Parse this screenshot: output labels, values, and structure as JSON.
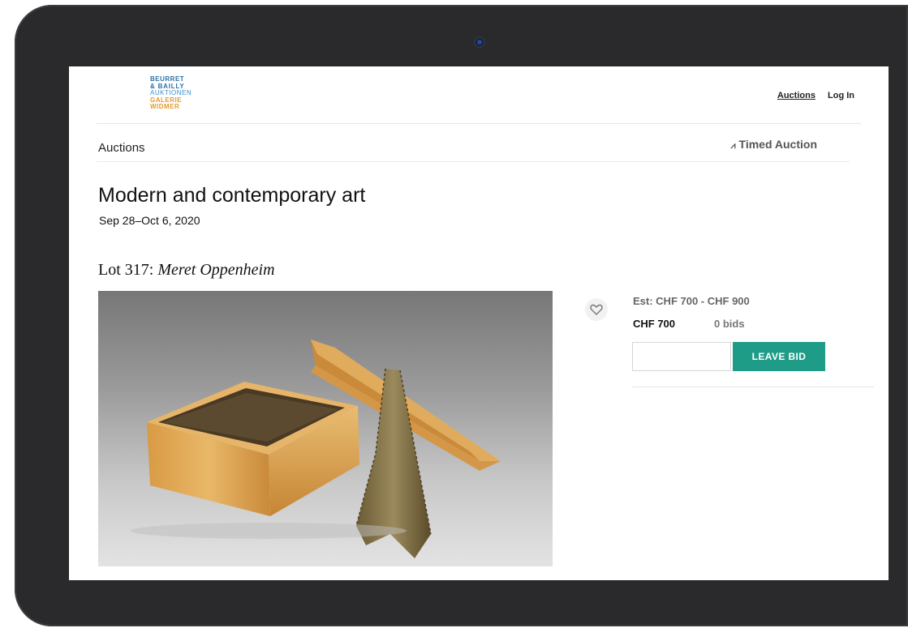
{
  "logo": {
    "line1": "BEURRET",
    "line2": "& BAILLY",
    "line3": "AUKTIONEN",
    "line4": "GALERIE",
    "line5": "WIDMER"
  },
  "nav": {
    "auctions": "Auctions",
    "login": "Log In"
  },
  "subnav": {
    "breadcrumb": "Auctions",
    "auction_type": "Timed Auction",
    "auction_type_icon": "rss-icon"
  },
  "auction": {
    "title": "Modern and contemporary art",
    "dates": "Sep 28–Oct 6, 2020"
  },
  "lot": {
    "label": "Lot 317:",
    "artist": "Meret Oppenheim",
    "image_icon": "artwork-photo",
    "favorite_icon": "heart-icon",
    "estimate": "Est: CHF  700 - CHF  900",
    "current_price": "CHF  700",
    "bids": "0 bids",
    "bid_placeholder": "",
    "bid_button": "LEAVE BID"
  },
  "colors": {
    "accent": "#1f9c88",
    "logo_blue": "#2b6fa8",
    "logo_orange": "#e29a2c",
    "device_bezel": "#2a2a2c"
  }
}
